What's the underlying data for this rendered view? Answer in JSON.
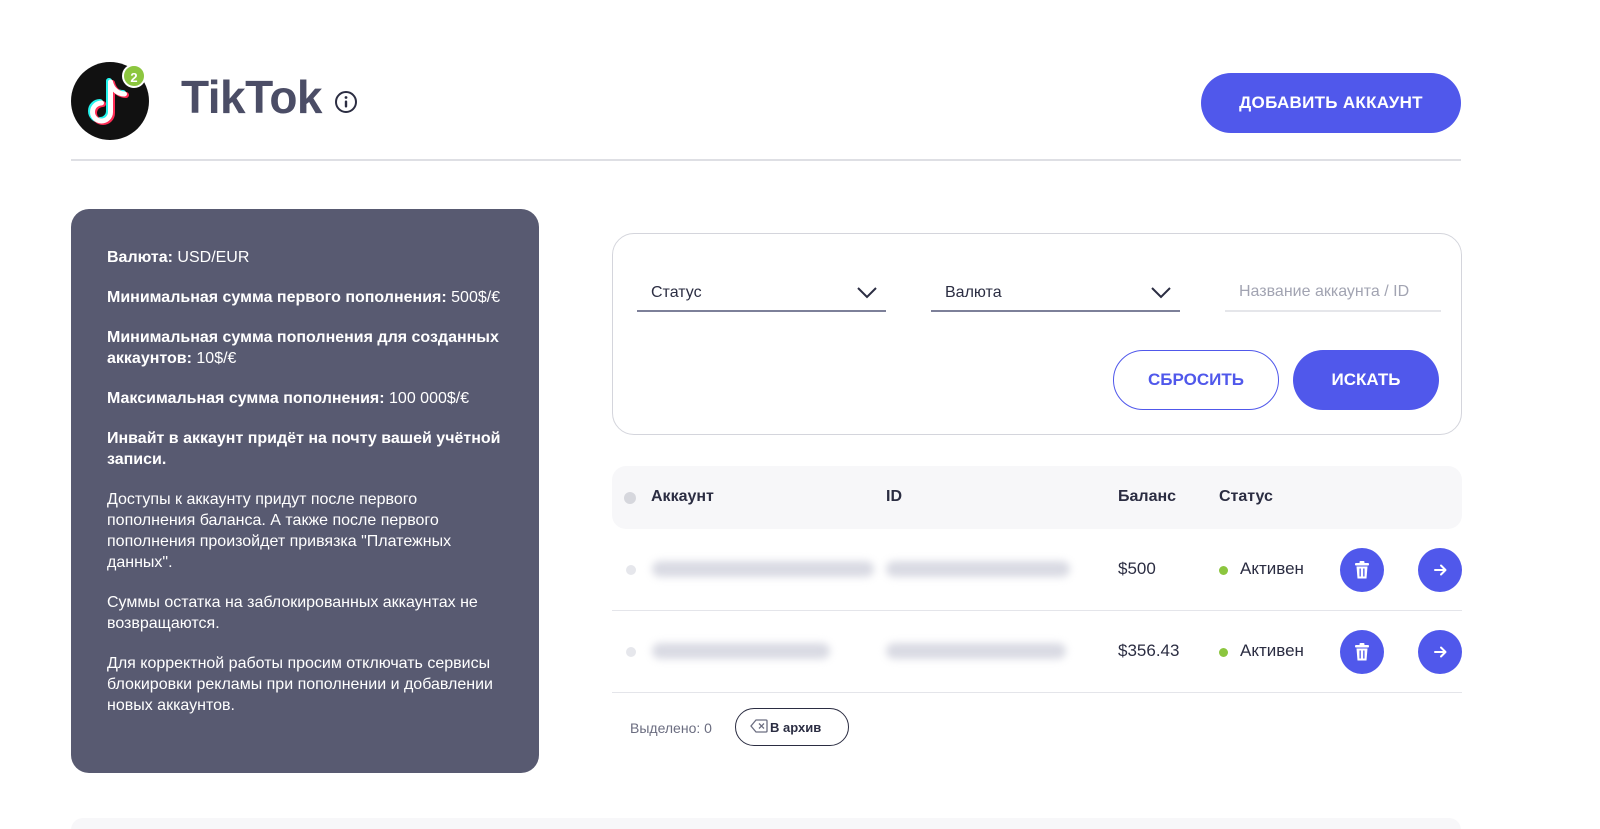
{
  "header": {
    "title": "TikTok",
    "badge_count": "2",
    "add_button_label": "ДОБАВИТЬ АККАУНТ",
    "logo_icon": "tiktok-logo",
    "info_icon": "info-icon"
  },
  "info_panel": {
    "currency_label": "Валюта:",
    "currency_value": "USD/EUR",
    "min_first_label": "Минимальная сумма первого пополнения:",
    "min_first_value": "500$/€",
    "min_created_label": "Минимальная сумма пополнения для созданных аккаунтов:",
    "min_created_value": "10$/€",
    "max_label": "Максимальная сумма пополнения:",
    "max_value": "100 000$/€",
    "invite_text": "Инвайт в аккаунт придёт на почту вашей учётной записи.",
    "access_text": "Доступы к аккаунту придут после первого пополнения баланса. А также после первого пополнения произойдет привязка \"Платежных данных\".",
    "blocked_text": "Суммы остатка на заблокированных аккаунтах не возвращаются.",
    "adblock_text": "Для корректной работы просим отключать сервисы блокировки рекламы при пополнении и добавлении новых аккаунтов."
  },
  "filters": {
    "status_label": "Статус",
    "currency_label": "Валюта",
    "search_placeholder": "Название аккаунта / ID",
    "reset_label": "СБРОСИТЬ",
    "search_label": "ИСКАТЬ"
  },
  "table": {
    "columns": {
      "account": "Аккаунт",
      "id": "ID",
      "balance": "Баланс",
      "status": "Статус"
    },
    "rows": [
      {
        "balance": "$500",
        "status": "Активен"
      },
      {
        "balance": "$356.43",
        "status": "Активен"
      }
    ]
  },
  "footer": {
    "selected_text": "Выделено: 0",
    "archive_label": "В архив"
  },
  "colors": {
    "accent": "#5058eb",
    "panel": "#585a71",
    "status_active": "#8cc63f"
  }
}
